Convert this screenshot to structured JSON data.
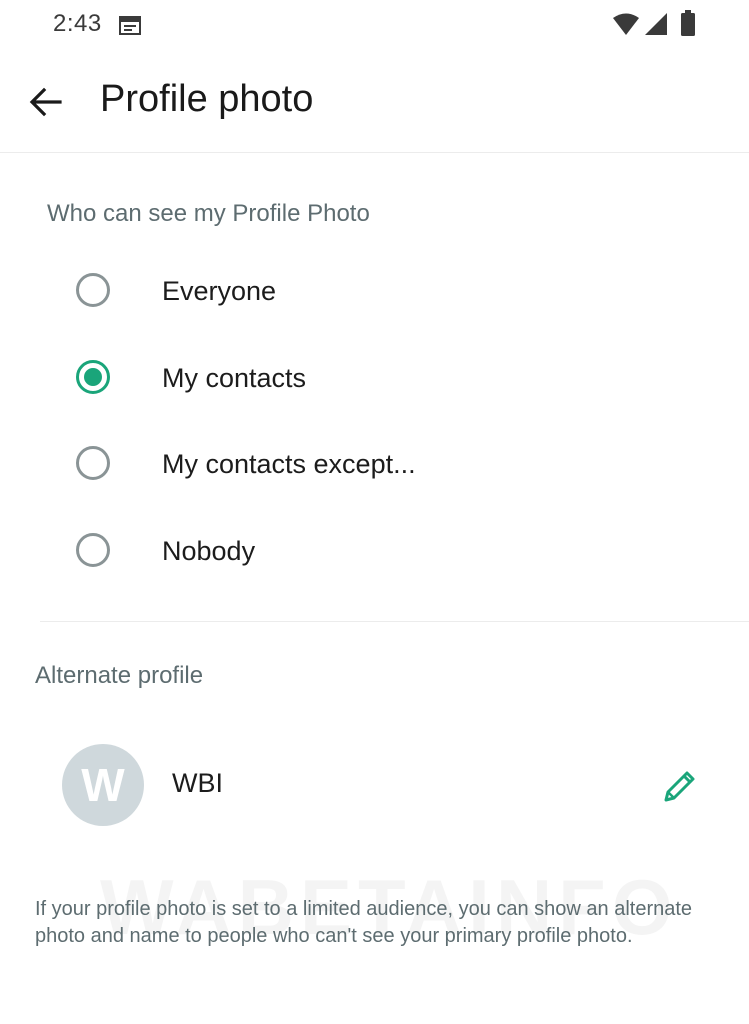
{
  "status_bar": {
    "time": "2:43",
    "icons": [
      "calendar-icon",
      "wifi-icon",
      "signal-icon",
      "battery-icon"
    ]
  },
  "app_bar": {
    "back_icon": "arrow-left-icon",
    "title": "Profile photo"
  },
  "visibility": {
    "heading": "Who can see my Profile Photo",
    "options": [
      {
        "label": "Everyone",
        "selected": false
      },
      {
        "label": "My contacts",
        "selected": true
      },
      {
        "label": "My contacts except...",
        "selected": false
      },
      {
        "label": "Nobody",
        "selected": false
      }
    ]
  },
  "alternate": {
    "heading": "Alternate profile",
    "avatar_initial": "W",
    "name": "WBI",
    "edit_icon": "pencil-icon"
  },
  "footer": {
    "note": "If your profile photo is set to a limited audience, you can show an alternate photo and name to people who can't see your primary profile photo."
  },
  "watermark": "WABETAINFO",
  "colors": {
    "accent": "#1aa57a",
    "secondary_text": "#5d6c70",
    "avatar_bg": "#cfd8dc"
  }
}
